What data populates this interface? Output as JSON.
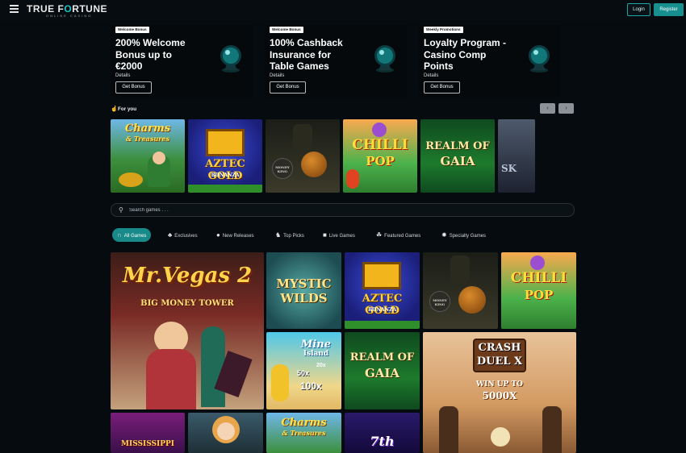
{
  "header": {
    "logo_main_pre": "TRUE F",
    "logo_main_accent": "O",
    "logo_main_post": "RTUNE",
    "logo_sub": "ONLINE CASINO",
    "login_label": "Login",
    "register_label": "Register"
  },
  "promos": [
    {
      "tag": "Welcome Bonus",
      "title": "200% Welcome Bonus up to €2000",
      "details": "Details",
      "button": "Get Bonus"
    },
    {
      "tag": "Welcome Bonus",
      "title": "100% Cashback Insurance for Table Games",
      "details": "Details",
      "button": "Get Bonus"
    },
    {
      "tag": "Weekly Promotions",
      "title": "Loyalty Program - Casino Comp Points",
      "details": "Details",
      "button": "Get Bonus"
    }
  ],
  "for_you": {
    "label": "For you",
    "prev": "‹",
    "next": "›",
    "games": [
      "Charms & Treasures",
      "Aztec Gold Bonanza",
      "Money King",
      "Chilli Pop",
      "Realm of Gaia",
      "Sky Queen"
    ]
  },
  "search": {
    "placeholder": "Search games . . ."
  },
  "categories": [
    {
      "label": "All Games",
      "icon": "horseshoe-icon",
      "active": true
    },
    {
      "label": "Exclusives",
      "icon": "cards-icon",
      "active": false
    },
    {
      "label": "New Releases",
      "icon": "chips-icon",
      "active": false
    },
    {
      "label": "Top Picks",
      "icon": "trophy-icon",
      "active": false
    },
    {
      "label": "Live Games",
      "icon": "dealer-icon",
      "active": false
    },
    {
      "label": "Featured Games",
      "icon": "clover-icon",
      "active": false
    },
    {
      "label": "Specialty Games",
      "icon": "wheel-icon",
      "active": false
    }
  ],
  "grid": {
    "mr_vegas": {
      "line1": "Mr.Vegas 2",
      "line2": "BIG MONEY TOWER"
    },
    "mystic_wilds": {
      "line1": "MYSTIC",
      "line2": "WILDS"
    },
    "aztec": {
      "line1": "AZTEC GOLD",
      "line2": "BONANZA"
    },
    "money_king": {
      "line1": "MONEY",
      "line2": "KING"
    },
    "chilli": {
      "line1": "CHILLI",
      "line2": "POP"
    },
    "mine_island": {
      "line1": "Mine",
      "line2": "Island",
      "mult1": "20x",
      "mult2": "50x",
      "mult3": "100x"
    },
    "realm": {
      "line1": "REALM OF",
      "line2": "GAIA"
    },
    "crash_duel": {
      "line1": "CRASH",
      "line2": "DUEL X",
      "line3": "WIN UP TO",
      "line4": "5000X"
    },
    "mississippi": {
      "line1": "MISSISSIPPI"
    },
    "charms": {
      "line1": "Charms",
      "line2": "& Treasures"
    },
    "seventh": {
      "line1": "7th"
    }
  }
}
